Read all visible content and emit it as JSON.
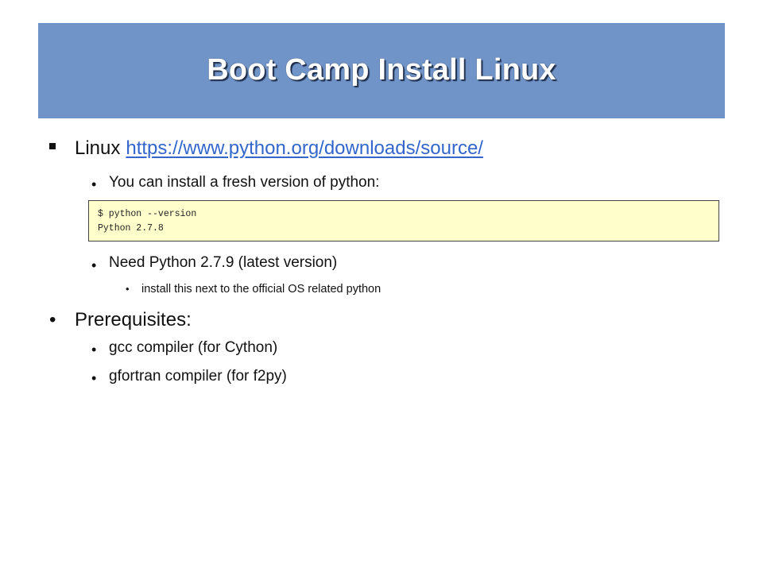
{
  "slide": {
    "title": "Boot Camp Install Linux",
    "colors": {
      "title_bar": "#7094c8",
      "title_text": "#ffffff",
      "link": "#3366cc",
      "code_background": "#ffffcc"
    }
  },
  "bullets": {
    "b1_prefix": "Linux",
    "b1_link": "https://www.python.org/downloads/source/",
    "b1_sub1": "You can install a fresh version of python:",
    "code_line_1": "$ python --version",
    "code_line_2": "Python 2.7.8",
    "b1_sub2": "Need Python 2.7.9 (latest version)",
    "b1_sub2_sub1": "install this next to the official OS related python",
    "b2": "Prerequisites:",
    "b2_sub1": "gcc compiler (for Cython)",
    "b2_sub2": "gfortran compiler (for f2py)"
  }
}
